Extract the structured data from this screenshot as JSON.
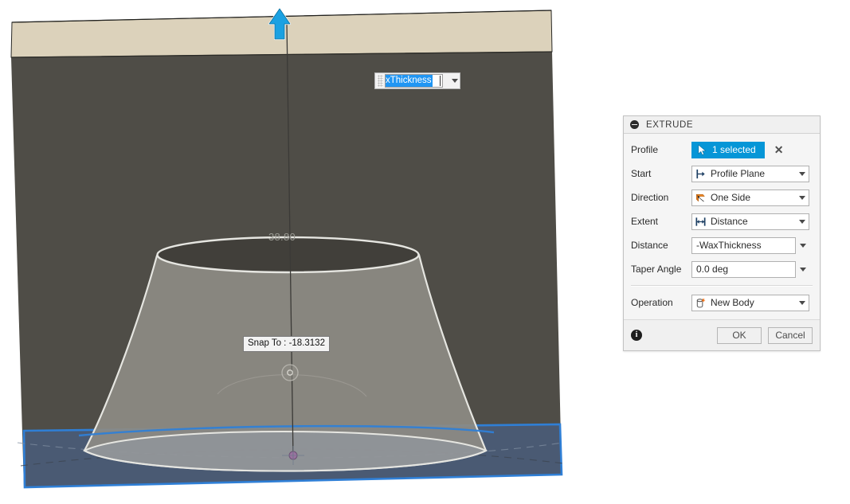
{
  "viewport": {
    "name": "3d-viewport",
    "dimension_label": "38.80",
    "snap_tooltip": "Snap To : -18.3132",
    "manipulator_arrow_icon": "arrow-up-icon",
    "canvas_input": {
      "value": "xThickness",
      "full_value": "-WaxThickness",
      "dropdown_icon": "chevron-down-icon"
    },
    "colors": {
      "top_band": "#dcd2bb",
      "background": "#4f4d47",
      "sketch_plane": "#4a5a73",
      "sketch_plane_highlight": "#2f7fd6",
      "body_fill": "#8d8b84",
      "body_top_fill": "#413f3a",
      "edge_highlight": "#e8e8e4",
      "origin_point": "#9a6fa0"
    }
  },
  "dialog": {
    "title": "EXTRUDE",
    "collapse_icon": "collapse-minus-icon",
    "rows": [
      {
        "label": "Profile",
        "type": "selection",
        "value": "1 selected",
        "icon": "cursor-arrow-icon",
        "clear_icon": "close-icon"
      },
      {
        "label": "Start",
        "type": "combo",
        "value": "Profile Plane",
        "icon": "profile-plane-icon",
        "dropdown_icon": "chevron-down-icon"
      },
      {
        "label": "Direction",
        "type": "combo",
        "value": "One Side",
        "icon": "one-side-icon",
        "dropdown_icon": "chevron-down-icon"
      },
      {
        "label": "Extent",
        "type": "combo",
        "value": "Distance",
        "icon": "distance-icon",
        "dropdown_icon": "chevron-down-icon"
      },
      {
        "label": "Distance",
        "type": "field",
        "value": "-WaxThickness",
        "dropdown_icon": "chevron-down-icon"
      },
      {
        "label": "Taper Angle",
        "type": "field",
        "value": "0.0 deg",
        "dropdown_icon": "chevron-down-icon"
      }
    ],
    "operation": {
      "label": "Operation",
      "value": "New Body",
      "icon": "new-body-icon",
      "dropdown_icon": "chevron-down-icon"
    },
    "footer": {
      "info_icon": "info-icon",
      "info_glyph": "i",
      "ok_label": "OK",
      "cancel_label": "Cancel"
    },
    "colors": {
      "accent": "#0696d7",
      "panel_bg": "#f0f0f0",
      "body_bg": "#f5f5f5",
      "border": "#c2c2c2"
    }
  }
}
